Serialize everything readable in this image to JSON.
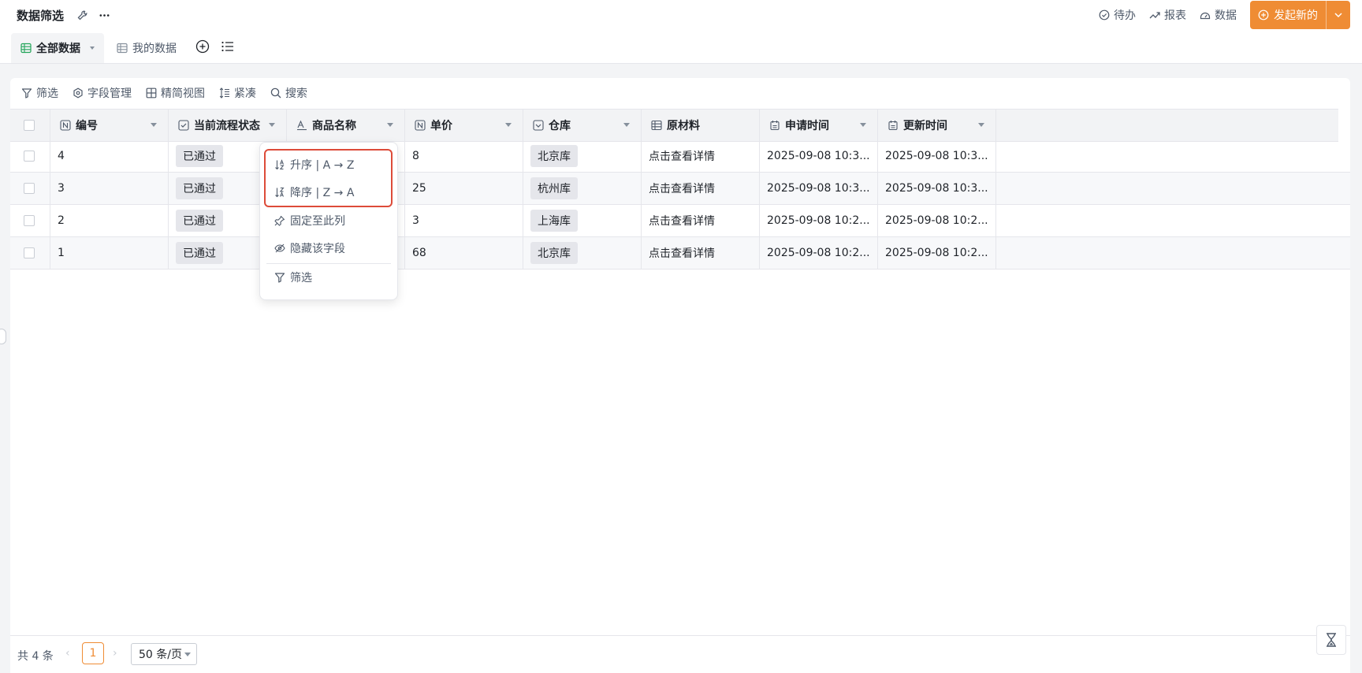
{
  "app": {
    "title": "数据筛选"
  },
  "top_actions": {
    "todo": "待办",
    "report": "报表",
    "data": "数据",
    "new_button": "发起新的"
  },
  "tabs": [
    {
      "label": "全部数据",
      "active": true
    },
    {
      "label": "我的数据",
      "active": false
    }
  ],
  "toolbar": {
    "filter": "筛选",
    "field_manage": "字段管理",
    "compact_view": "精简视图",
    "density": "紧凑",
    "search": "搜索"
  },
  "columns": [
    "编号",
    "当前流程状态",
    "商品名称",
    "单价",
    "仓库",
    "原材料",
    "申请时间",
    "更新时间"
  ],
  "rows": [
    {
      "id": "4",
      "status": "已通过",
      "price": "8",
      "warehouse": "北京库",
      "material": "点击查看详情",
      "applied": "2025-09-08 10:3...",
      "updated": "2025-09-08 10:3..."
    },
    {
      "id": "3",
      "status": "已通过",
      "price": "25",
      "warehouse": "杭州库",
      "material": "点击查看详情",
      "applied": "2025-09-08 10:3...",
      "updated": "2025-09-08 10:3..."
    },
    {
      "id": "2",
      "status": "已通过",
      "price": "3",
      "warehouse": "上海库",
      "material": "点击查看详情",
      "applied": "2025-09-08 10:2...",
      "updated": "2025-09-08 10:2..."
    },
    {
      "id": "1",
      "status": "已通过",
      "price": "68",
      "warehouse": "北京库",
      "material": "点击查看详情",
      "applied": "2025-09-08 10:2...",
      "updated": "2025-09-08 10:2..."
    }
  ],
  "context_menu": {
    "sort_asc": "升序 | A → Z",
    "sort_desc": "降序 | Z → A",
    "pin_column": "固定至此列",
    "hide_field": "隐藏该字段",
    "filter": "筛选"
  },
  "footer": {
    "total": "共 4 条",
    "current_page": "1",
    "page_size": "50 条/页"
  },
  "colors": {
    "accent": "#ef8c34",
    "highlight_border": "#dd4b39",
    "tab_icon_green": "#23a55a"
  }
}
